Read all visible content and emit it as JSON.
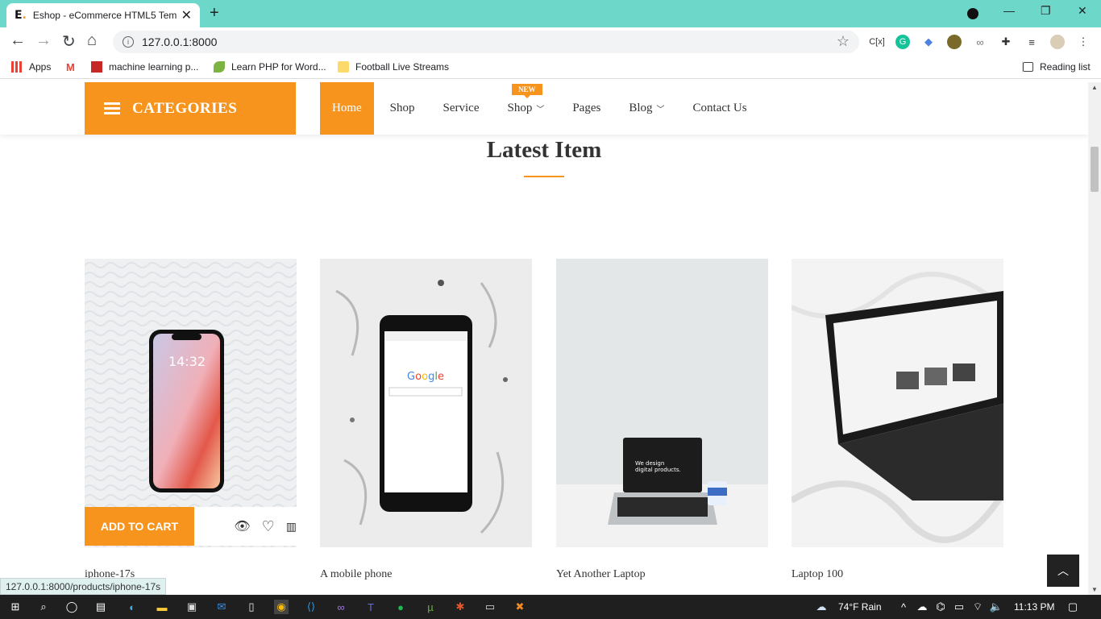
{
  "browser": {
    "tab_title": "Eshop - eCommerce HTML5 Tem",
    "favicon_text": "E",
    "url": "127.0.0.1:8000",
    "bookmarks": [
      "Apps",
      "machine learning p...",
      "Learn PHP for Word...",
      "Football Live Streams"
    ],
    "reading_list": "Reading list",
    "status_url": "127.0.0.1:8000/products/iphone-17s"
  },
  "header": {
    "categories_label": "CATEGORIES",
    "menu": [
      {
        "label": "Home",
        "active": true
      },
      {
        "label": "Shop"
      },
      {
        "label": "Service"
      },
      {
        "label": "Shop",
        "dropdown": true
      },
      {
        "label": "Pages"
      },
      {
        "label": "Blog",
        "dropdown": true
      },
      {
        "label": "Contact Us"
      }
    ],
    "new_badge": "NEW"
  },
  "section": {
    "title": "Latest Item"
  },
  "products": [
    {
      "name": "iphone-17s",
      "image": "phone-on-fabric"
    },
    {
      "name": "A mobile phone",
      "image": "phone-on-marble"
    },
    {
      "name": "Yet Another Laptop",
      "image": "laptop-on-desk"
    },
    {
      "name": "Laptop 100",
      "image": "laptop-on-bed"
    }
  ],
  "card_actions": {
    "add_to_cart": "ADD TO CART"
  },
  "taskbar": {
    "weather": "74°F  Rain",
    "time": "11:13 PM"
  },
  "colors": {
    "accent": "#f7941d",
    "chrome": "#6dd7c9",
    "taskbar": "#1f1f1f"
  }
}
